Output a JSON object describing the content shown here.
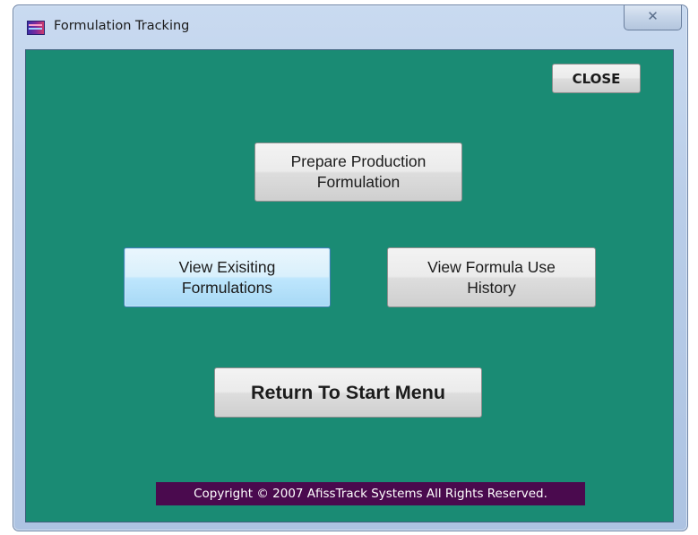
{
  "window": {
    "title": "Formulation Tracking",
    "close_glyph": "✕",
    "icon": "app-logo-icon"
  },
  "buttons": {
    "close": "CLOSE",
    "prepare_production": "Prepare Production\nFormulation",
    "view_existing": "View Exisiting\nFormulations",
    "view_history": "View Formula Use\nHistory",
    "return_start": "Return To Start Menu"
  },
  "footer": {
    "copyright": "Copyright © 2007 AfissTrack Systems All Rights Reserved."
  },
  "colors": {
    "background": "#1a8b74",
    "copyright_bg": "#4a0a4e",
    "focused_button": "#bee6fd"
  }
}
